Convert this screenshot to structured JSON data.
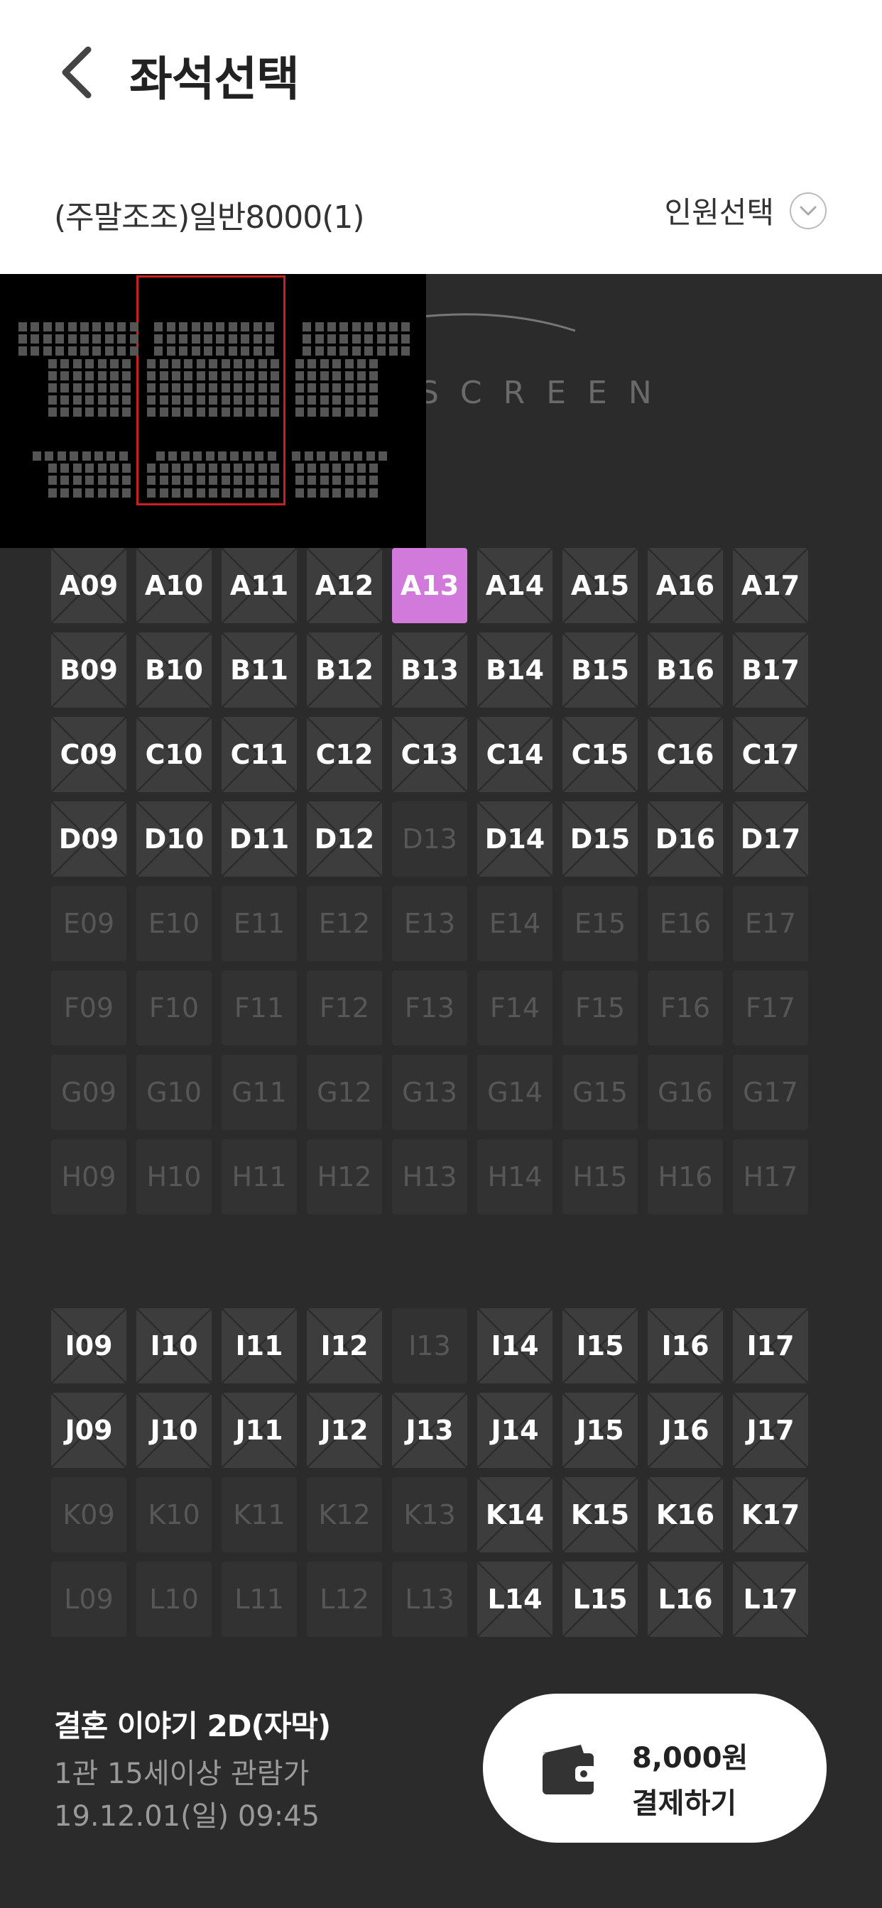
{
  "header": {
    "title": "좌석선택",
    "ticket_type": "(주말조조)일반8000(1)",
    "people_select_label": "인원선택"
  },
  "screen_label": "SCREEN",
  "seats": {
    "columns": [
      "09",
      "10",
      "11",
      "12",
      "13",
      "14",
      "15",
      "16",
      "17"
    ],
    "rows": [
      {
        "row": "A",
        "disabled": [],
        "selected": [
          "13"
        ]
      },
      {
        "row": "B",
        "disabled": [],
        "selected": []
      },
      {
        "row": "C",
        "disabled": [],
        "selected": []
      },
      {
        "row": "D",
        "disabled": [
          "13"
        ],
        "selected": []
      },
      {
        "row": "E",
        "disabled": [
          "09",
          "10",
          "11",
          "12",
          "13",
          "14",
          "15",
          "16",
          "17"
        ],
        "selected": []
      },
      {
        "row": "F",
        "disabled": [
          "09",
          "10",
          "11",
          "12",
          "13",
          "14",
          "15",
          "16",
          "17"
        ],
        "selected": []
      },
      {
        "row": "G",
        "disabled": [
          "09",
          "10",
          "11",
          "12",
          "13",
          "14",
          "15",
          "16",
          "17"
        ],
        "selected": []
      },
      {
        "row": "H",
        "disabled": [
          "09",
          "10",
          "11",
          "12",
          "13",
          "14",
          "15",
          "16",
          "17"
        ],
        "selected": []
      },
      {
        "row": "I",
        "disabled": [
          "13"
        ],
        "selected": []
      },
      {
        "row": "J",
        "disabled": [],
        "selected": []
      },
      {
        "row": "K",
        "disabled": [
          "09",
          "10",
          "11",
          "12",
          "13"
        ],
        "selected": []
      },
      {
        "row": "L",
        "disabled": [
          "09",
          "10",
          "11",
          "12",
          "13"
        ],
        "selected": []
      }
    ]
  },
  "movie": {
    "title": "결혼 이야기 2D(자막)",
    "hall_rating": "1관 15세이상 관람가",
    "datetime": "19.12.01(일) 09:45"
  },
  "payment": {
    "amount": "8,000원",
    "label": "결제하기"
  },
  "colors": {
    "selected_seat": "#d27adb",
    "seat_available": "#3d3d3d",
    "seat_disabled": "#323232",
    "minimap_frame": "#cc1f1f"
  }
}
